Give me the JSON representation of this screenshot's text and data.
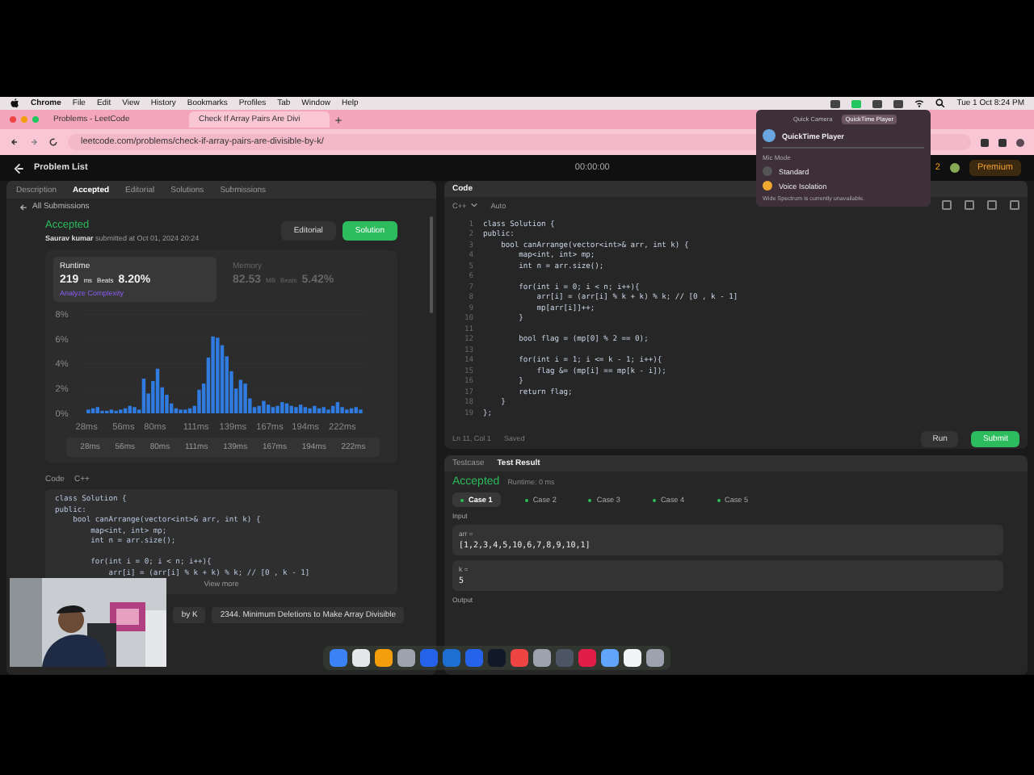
{
  "menubar": {
    "items": [
      "Chrome",
      "File",
      "Edit",
      "View",
      "History",
      "Bookmarks",
      "Profiles",
      "Tab",
      "Window",
      "Help"
    ],
    "clock": "Tue 1 Oct 8:24 PM"
  },
  "browser": {
    "tabs": [
      {
        "title": "Problems - LeetCode",
        "selected": false
      },
      {
        "title": "Check If Array Pairs Are Divi",
        "selected": true
      }
    ],
    "url": "leetcode.com/problems/check-if-array-pairs-are-divisible-by-k/"
  },
  "nav": {
    "title": "Problem List",
    "timer": "00:00:00",
    "streak": "2",
    "premium": "Premium"
  },
  "popup": {
    "tabs": [
      {
        "label": "Quick Camera",
        "selected": false
      },
      {
        "label": "QuickTime Player",
        "selected": true
      }
    ],
    "app": "QuickTime Player",
    "section": "Mic Mode",
    "options": [
      {
        "label": "Standard",
        "selected": false
      },
      {
        "label": "Voice Isolation",
        "selected": true
      }
    ],
    "note": "Wide Spectrum is currently unavailable."
  },
  "left_tabs": [
    {
      "label": "Description",
      "selected": false
    },
    {
      "label": "Accepted",
      "selected": true
    },
    {
      "label": "Editorial",
      "selected": false
    },
    {
      "label": "Solutions",
      "selected": false
    },
    {
      "label": "Submissions",
      "selected": false
    }
  ],
  "back_link": "All Submissions",
  "submission": {
    "status": "Accepted",
    "author": "Saurav kumar",
    "submitted": "submitted at Oct 01, 2024 20:24",
    "buttons": [
      "Editorial",
      "Solution"
    ],
    "metrics": [
      {
        "label": "Runtime",
        "value": "219",
        "unit": "ms",
        "beats_label": "Beats",
        "beats": "8.20%",
        "selected": true
      },
      {
        "label": "Memory",
        "value": "82.53",
        "unit": "MB",
        "beats_label": "Beats",
        "beats": "5.42%",
        "selected": false
      }
    ],
    "analyze_link": "Analyze Complexity",
    "chart_data": {
      "type": "bar",
      "x": [
        28,
        31.5,
        35,
        38.5,
        42,
        45.5,
        49,
        52.5,
        56,
        59.5,
        63,
        66.5,
        70,
        73.5,
        77,
        80.5,
        84,
        87.5,
        91,
        94.5,
        98,
        101.5,
        105,
        108.5,
        112,
        115.5,
        119,
        122.5,
        126,
        129.5,
        133,
        136.5,
        140,
        143.5,
        147,
        150.5,
        154,
        157.5,
        161,
        164.5,
        168,
        171.5,
        175,
        178.5,
        182,
        185.5,
        189,
        192.5,
        196,
        199.5,
        203,
        206.5,
        210,
        213.5,
        217,
        220.5,
        224,
        227.5,
        231,
        234.5
      ],
      "xlim": [
        26,
        238
      ],
      "values": [
        0.3,
        0.4,
        0.5,
        0.2,
        0.2,
        0.3,
        0.2,
        0.3,
        0.4,
        0.6,
        0.5,
        0.3,
        2.8,
        1.6,
        2.6,
        3.6,
        2.1,
        1.5,
        0.8,
        0.4,
        0.3,
        0.3,
        0.4,
        0.6,
        1.9,
        2.4,
        4.5,
        6.2,
        6.1,
        5.5,
        4.6,
        3.4,
        2.0,
        2.7,
        2.4,
        1.2,
        0.5,
        0.6,
        1.0,
        0.7,
        0.5,
        0.6,
        0.9,
        0.8,
        0.6,
        0.5,
        0.7,
        0.5,
        0.4,
        0.6,
        0.4,
        0.5,
        0.3,
        0.6,
        0.9,
        0.5,
        0.3,
        0.4,
        0.5,
        0.3
      ],
      "ylim": [
        0,
        8
      ],
      "yticks": [
        {
          "value": 0,
          "label": "0%"
        },
        {
          "value": 2,
          "label": "2%"
        },
        {
          "value": 4,
          "label": "4%"
        },
        {
          "value": 6,
          "label": "6%"
        },
        {
          "value": 8,
          "label": "8%"
        }
      ],
      "xticks": [
        {
          "value": 28,
          "label": "28ms"
        },
        {
          "value": 56,
          "label": "56ms"
        },
        {
          "value": 80,
          "label": "80ms"
        },
        {
          "value": 111,
          "label": "111ms"
        },
        {
          "value": 139,
          "label": "139ms"
        },
        {
          "value": 167,
          "label": "167ms"
        },
        {
          "value": 194,
          "label": "194ms"
        },
        {
          "value": 222,
          "label": "222ms"
        }
      ]
    },
    "navigator_labels": [
      "28ms",
      "56ms",
      "80ms",
      "111ms",
      "139ms",
      "167ms",
      "194ms",
      "222ms"
    ],
    "code_label": "Code",
    "code_lang": "C++",
    "code_blocks": [
      [
        "class Solution {",
        "public:",
        "    bool canArrange(vector<int>& arr, int k) {",
        "        map<int, int> mp;",
        "        int n = arr.size();"
      ],
      [
        "        for(int i = 0; i < n; i++){",
        "            arr[i] = (arr[i] % k + k) % k; // [0 , k - 1]"
      ]
    ],
    "view_more": "View more"
  },
  "related": [
    "by K",
    "2344. Minimum Deletions to Make Array Divisible"
  ],
  "editor": {
    "title": "Code",
    "lang": "C++",
    "mode": "Auto",
    "lines": [
      {
        "n": "1",
        "text": "class Solution {"
      },
      {
        "n": "2",
        "text": "public:"
      },
      {
        "n": "3",
        "text": "    bool canArrange(vector<int>& arr, int k) {"
      },
      {
        "n": "4",
        "text": "        map<int, int> mp;"
      },
      {
        "n": "5",
        "text": "        int n = arr.size();"
      },
      {
        "n": "6"
      },
      {
        "n": "7",
        "text": "        for(int i = 0; i < n; i++){"
      },
      {
        "n": "8",
        "text": "            arr[i] = (arr[i] % k + k) % k; // [0 , k - 1]"
      },
      {
        "n": "9",
        "text": "            mp[arr[i]]++;"
      },
      {
        "n": "10",
        "text": "        }"
      },
      {
        "n": "11"
      },
      {
        "n": "12",
        "text": "        bool flag = (mp[0] % 2 == 0);"
      },
      {
        "n": "13"
      },
      {
        "n": "14",
        "text": "        for(int i = 1; i <= k - 1; i++){"
      },
      {
        "n": "15",
        "text": "            flag &= (mp[i] == mp[k - i]);"
      },
      {
        "n": "16",
        "text": "        }"
      },
      {
        "n": "17",
        "text": "        return flag;"
      },
      {
        "n": "18",
        "text": "    }"
      },
      {
        "n": "19",
        "text": "};"
      }
    ],
    "position": "Ln 11, Col 1",
    "saved": "Saved",
    "run": "Run",
    "submit": "Submit"
  },
  "test": {
    "tabs": [
      {
        "label": "Testcase",
        "selected": false
      },
      {
        "label": "Test Result",
        "selected": true
      }
    ],
    "status": "Accepted",
    "runtime": "Runtime: 0 ms",
    "cases": [
      {
        "label": "Case 1",
        "selected": true
      },
      {
        "label": "Case 2",
        "selected": false
      },
      {
        "label": "Case 3",
        "selected": false
      },
      {
        "label": "Case 4",
        "selected": false
      },
      {
        "label": "Case 5",
        "selected": false
      }
    ],
    "input_label": "Input",
    "inputs": [
      {
        "name": "arr =",
        "value": "[1,2,3,4,5,10,6,7,8,9,10,1]"
      },
      {
        "name": "k =",
        "value": "5"
      }
    ],
    "output_label": "Output"
  }
}
